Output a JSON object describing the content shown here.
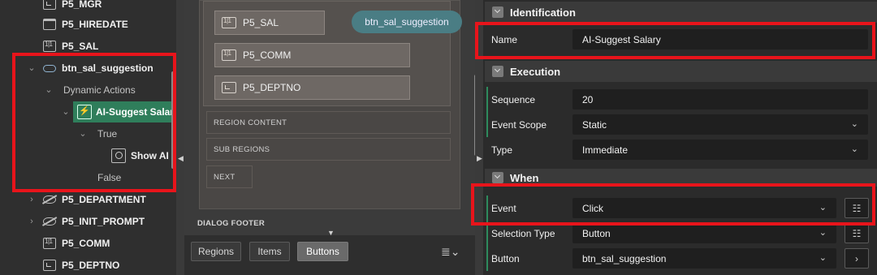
{
  "tree": {
    "items": [
      {
        "label": "P5_MGR",
        "icon": "select-list-icon"
      },
      {
        "label": "P5_HIREDATE",
        "icon": "date-picker-icon"
      },
      {
        "label": "P5_SAL",
        "icon": "number-field-icon"
      },
      {
        "label": "btn_sal_suggestion",
        "icon": "button-icon"
      },
      {
        "label": "Dynamic Actions"
      },
      {
        "label": "AI-Suggest Salary",
        "icon": "lightning-icon"
      },
      {
        "label": "True"
      },
      {
        "label": "Show AI A",
        "icon": "ai-action-icon"
      },
      {
        "label": "False"
      },
      {
        "label": "P5_DEPARTMENT",
        "icon": "hidden-item-icon"
      },
      {
        "label": "P5_INIT_PROMPT",
        "icon": "hidden-item-icon"
      },
      {
        "label": "P5_COMM",
        "icon": "number-field-icon"
      },
      {
        "label": "P5_DEPTNO",
        "icon": "select-list-icon"
      }
    ]
  },
  "layout": {
    "items": [
      "P5_SAL",
      "P5_COMM",
      "P5_DEPTNO"
    ],
    "button_label": "btn_sal_suggestion",
    "positions": [
      "REGION CONTENT",
      "SUB REGIONS",
      "NEXT"
    ],
    "footer_label": "DIALOG FOOTER",
    "tabs": [
      "Regions",
      "Items",
      "Buttons"
    ],
    "active_tab": "Buttons"
  },
  "props": {
    "sections": {
      "identification": "Identification",
      "execution": "Execution",
      "when": "When"
    },
    "name_label": "Name",
    "name_value": "AI-Suggest Salary",
    "sequence_label": "Sequence",
    "sequence_value": "20",
    "event_scope_label": "Event Scope",
    "event_scope_value": "Static",
    "type_label": "Type",
    "type_value": "Immediate",
    "event_label": "Event",
    "event_value": "Click",
    "selection_type_label": "Selection Type",
    "selection_type_value": "Button",
    "button_label": "Button",
    "button_value": "btn_sal_suggestion"
  },
  "colors": {
    "highlight": "#e8141b",
    "selected_node": "#2f7e5b",
    "button_pill": "#4a7d84"
  }
}
